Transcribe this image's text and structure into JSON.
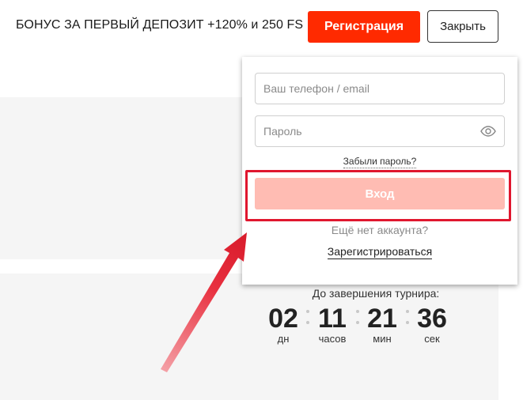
{
  "header": {
    "bonus_text": "БОНУС ЗА ПЕРВЫЙ ДЕПОЗИТ +120% и 250 FS",
    "register_label": "Регистрация",
    "close_label": "Закрыть"
  },
  "login": {
    "phone_placeholder": "Ваш телефон / email",
    "password_placeholder": "Пароль",
    "forgot_label": "Забыли пароль?",
    "login_label": "Вход",
    "no_account_text": "Ещё нет аккаунта?",
    "signup_label": "Зарегистрироваться"
  },
  "tournament": {
    "label": "До завершения турнира:",
    "days": "02",
    "days_label": "дн",
    "hours": "11",
    "hours_label": "часов",
    "minutes": "21",
    "minutes_label": "мин",
    "seconds": "36",
    "seconds_label": "сек"
  },
  "colors": {
    "accent": "#ff2a00",
    "login_disabled": "#ffbcb3",
    "annotation": "#e0172f"
  },
  "icons": {
    "password_toggle": "eye-icon"
  }
}
